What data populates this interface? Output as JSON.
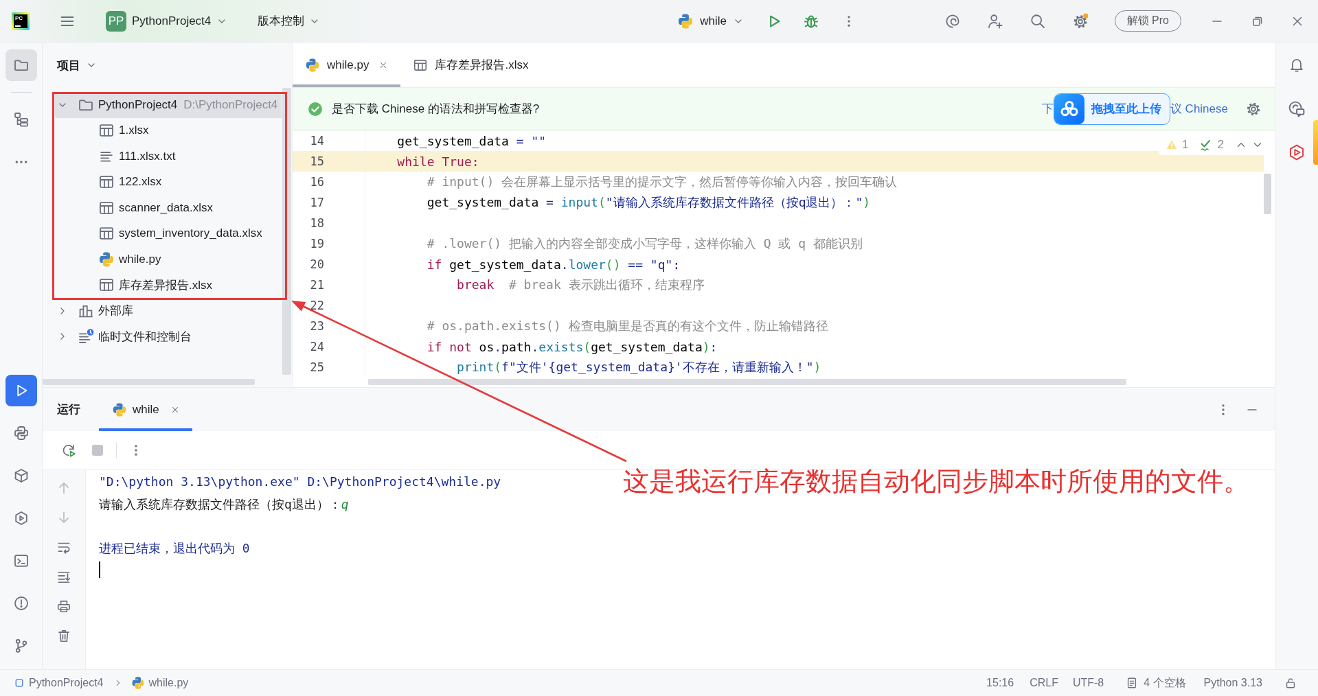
{
  "title_bar": {
    "logo_text": "PC",
    "project_badge": "PP",
    "project": "PythonProject4",
    "vcs": "版本控制",
    "run_config": "while",
    "unlock_button": "解锁 Pro"
  },
  "left_toolbar": {
    "top": [
      {
        "kind": "folder",
        "selected": true
      },
      {
        "kind": "structure",
        "selected": false
      },
      {
        "kind": "more",
        "selected": false
      }
    ],
    "bottom": [
      {
        "kind": "run",
        "selected": true
      },
      {
        "kind": "console",
        "selected": false
      },
      {
        "kind": "packages",
        "selected": false
      },
      {
        "kind": "services",
        "selected": false
      },
      {
        "kind": "terminal",
        "selected": false
      },
      {
        "kind": "problems",
        "selected": false
      },
      {
        "kind": "git",
        "selected": false
      }
    ]
  },
  "project_panel": {
    "title": "项目",
    "tree": [
      {
        "name": "PythonProject4",
        "path": "D:\\PythonProject4",
        "kind": "folder",
        "expanded": true,
        "selected": true,
        "children": [
          {
            "name": "1.xlsx",
            "kind": "sheet",
            "selected": false
          },
          {
            "name": "111.xlsx.txt",
            "kind": "text",
            "selected": false
          },
          {
            "name": "122.xlsx",
            "kind": "sheet",
            "selected": false
          },
          {
            "name": "scanner_data.xlsx",
            "kind": "sheet",
            "selected": false
          },
          {
            "name": "system_inventory_data.xlsx",
            "kind": "sheet",
            "selected": false
          },
          {
            "name": "while.py",
            "kind": "python",
            "selected": false
          },
          {
            "name": "库存差异报告.xlsx",
            "kind": "sheet",
            "selected": false
          }
        ]
      },
      {
        "name": "外部库",
        "kind": "library",
        "expanded": false,
        "selected": false
      },
      {
        "name": "临时文件和控制台",
        "kind": "scratch",
        "expanded": false,
        "selected": false
      }
    ]
  },
  "editor": {
    "tabs": [
      {
        "label": "while.py",
        "kind": "python",
        "selected": true
      },
      {
        "label": "库存差异报告.xlsx",
        "kind": "sheet",
        "selected": false
      }
    ],
    "banner": {
      "message": "是否下载 Chinese 的语法和拼写检查器?",
      "action_left": "下",
      "action_right": "议 Chinese"
    },
    "upload_popup": "拖拽至此上传",
    "inspections": {
      "warnings": "1",
      "typos": "2"
    },
    "lines": [
      {
        "number": "14",
        "current": false,
        "tokens": [
          {
            "kind": "plain",
            "text": "    get_system_data "
          },
          {
            "kind": "op",
            "text": "= "
          },
          {
            "kind": "string",
            "text": "\"\""
          }
        ]
      },
      {
        "number": "15",
        "current": true,
        "tokens": [
          {
            "kind": "keyword",
            "text": "    while True:"
          }
        ]
      },
      {
        "number": "16",
        "current": false,
        "tokens": [
          {
            "kind": "comment",
            "text": "        # input() 会在屏幕上显示括号里的提示文字，然后暂停等你输入内容，按回车确认"
          }
        ]
      },
      {
        "number": "17",
        "current": false,
        "tokens": [
          {
            "kind": "plain",
            "text": "        get_system_data "
          },
          {
            "kind": "op",
            "text": "= "
          },
          {
            "kind": "func",
            "text": "input"
          },
          {
            "kind": "paren",
            "text": "("
          },
          {
            "kind": "string",
            "text": "\"请输入系统库存数据文件路径（按q退出）：\""
          },
          {
            "kind": "paren",
            "text": ")"
          }
        ]
      },
      {
        "number": "18",
        "current": false
      },
      {
        "number": "19",
        "current": false,
        "tokens": [
          {
            "kind": "comment",
            "text": "        # .lower() 把输入的内容全部变成小写字母，这样你输入 Q 或 q 都能识别"
          }
        ]
      },
      {
        "number": "20",
        "current": false,
        "tokens": [
          {
            "kind": "keyword",
            "text": "        if"
          },
          {
            "kind": "plain",
            "text": " get_system_data"
          },
          {
            "kind": "op",
            "text": "."
          },
          {
            "kind": "func",
            "text": "lower"
          },
          {
            "kind": "paren",
            "text": "()"
          },
          {
            "kind": "op",
            "text": " == "
          },
          {
            "kind": "string",
            "text": "\"q\""
          },
          {
            "kind": "op",
            "text": ":"
          }
        ]
      },
      {
        "number": "21",
        "current": false,
        "tokens": [
          {
            "kind": "keyword",
            "text": "            break"
          },
          {
            "kind": "comment",
            "text": "  # break 表示跳出循环，结束程序"
          }
        ]
      },
      {
        "number": "22",
        "current": false
      },
      {
        "number": "23",
        "current": false,
        "tokens": [
          {
            "kind": "comment",
            "text": "        # os.path.exists() 检查电脑里是否真的有这个文件，防止输错路径"
          }
        ]
      },
      {
        "number": "24",
        "current": false,
        "tokens": [
          {
            "kind": "keyword",
            "text": "        if not"
          },
          {
            "kind": "plain",
            "text": " os"
          },
          {
            "kind": "op",
            "text": "."
          },
          {
            "kind": "plain",
            "text": "path"
          },
          {
            "kind": "op",
            "text": "."
          },
          {
            "kind": "func",
            "text": "exists"
          },
          {
            "kind": "paren",
            "text": "("
          },
          {
            "kind": "plain",
            "text": "get_system_data"
          },
          {
            "kind": "paren",
            "text": ")"
          },
          {
            "kind": "op",
            "text": ":"
          }
        ]
      },
      {
        "number": "25",
        "current": false,
        "tokens": [
          {
            "kind": "func",
            "text": "            print"
          },
          {
            "kind": "paren",
            "text": "("
          },
          {
            "kind": "string",
            "text": "f\"文件'{get_system_data}'不存在，请重新输入！\""
          },
          {
            "kind": "paren",
            "text": ")"
          }
        ]
      }
    ]
  },
  "run_panel": {
    "title": "运行",
    "tabs": [
      {
        "label": "while",
        "kind": "python",
        "selected": true
      }
    ],
    "toolbar": [
      {
        "kind": "rerun",
        "disabled": false
      },
      {
        "kind": "stop",
        "disabled": true
      },
      {
        "kind": "more",
        "disabled": false
      }
    ],
    "gutter": [
      {
        "kind": "up",
        "disabled": true
      },
      {
        "kind": "down",
        "disabled": true
      },
      {
        "kind": "wrap",
        "disabled": false
      },
      {
        "kind": "scroll",
        "disabled": false
      },
      {
        "kind": "print",
        "disabled": false
      },
      {
        "kind": "clear",
        "disabled": false
      }
    ],
    "console": [
      {
        "kind": "command",
        "text": "\"D:\\python 3.13\\python.exe\" D:\\PythonProject4\\while.py"
      },
      {
        "kind": "prompt",
        "text": "请输入系统库存数据文件路径（按q退出）：",
        "input": "q"
      },
      {
        "kind": "exit",
        "text": "进程已结束，退出代码为 0"
      }
    ]
  },
  "status_bar": {
    "breadcrumbs": [
      {
        "label": "PythonProject4",
        "kind": "module"
      },
      {
        "label": "while.py",
        "kind": "python"
      }
    ],
    "position": "15:16",
    "line_separator": "CRLF",
    "encoding": "UTF-8",
    "indent": "4 个空格",
    "interpreter": "Python 3.13"
  },
  "annotation": {
    "text": "这是我运行库存数据自动化同步脚本时所使用的文件。"
  }
}
